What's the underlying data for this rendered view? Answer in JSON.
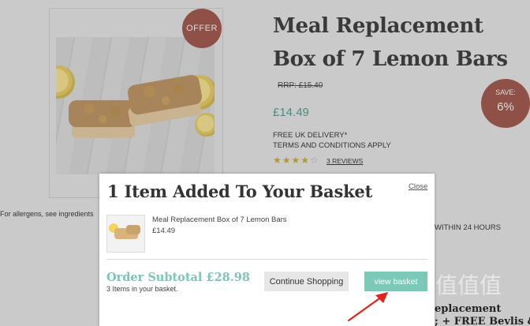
{
  "product": {
    "title": "Meal Replacement Box of 7 Lemon Bars",
    "rrp": "RRP: £15.40",
    "price": "£14.49",
    "delivery_line1": "FREE UK DELIVERY*",
    "delivery_line2": "TERMS AND CONDITIONS APPLY",
    "rating_stars": "★★★★",
    "rating_empty": "☆",
    "reviews_link": "3 REVIEWS",
    "offer_badge": "OFFER",
    "save_label": "SAVE:",
    "save_value": "6%",
    "allergens_text": "For allergens, see ingredients",
    "dispatch_text": "WITHIN 24 HOURS",
    "description_line1": "eplacement",
    "description_line2": "; + FREE Bevlis &"
  },
  "watermark": "值值值",
  "modal": {
    "title": "1 Item  Added To Your Basket",
    "close_label": "Close",
    "item_name": "Meal Replacement Box of 7 Lemon Bars",
    "item_price": "£14.49",
    "subtotal": "Order Subtotal £28.98",
    "items_count": "3 Items in your basket.",
    "continue_label": "Continue Shopping",
    "view_basket_label": "view basket"
  },
  "colors": {
    "accent_teal": "#7cc9b8",
    "badge_red": "#8f5047",
    "annotation_red": "#e0241b"
  }
}
